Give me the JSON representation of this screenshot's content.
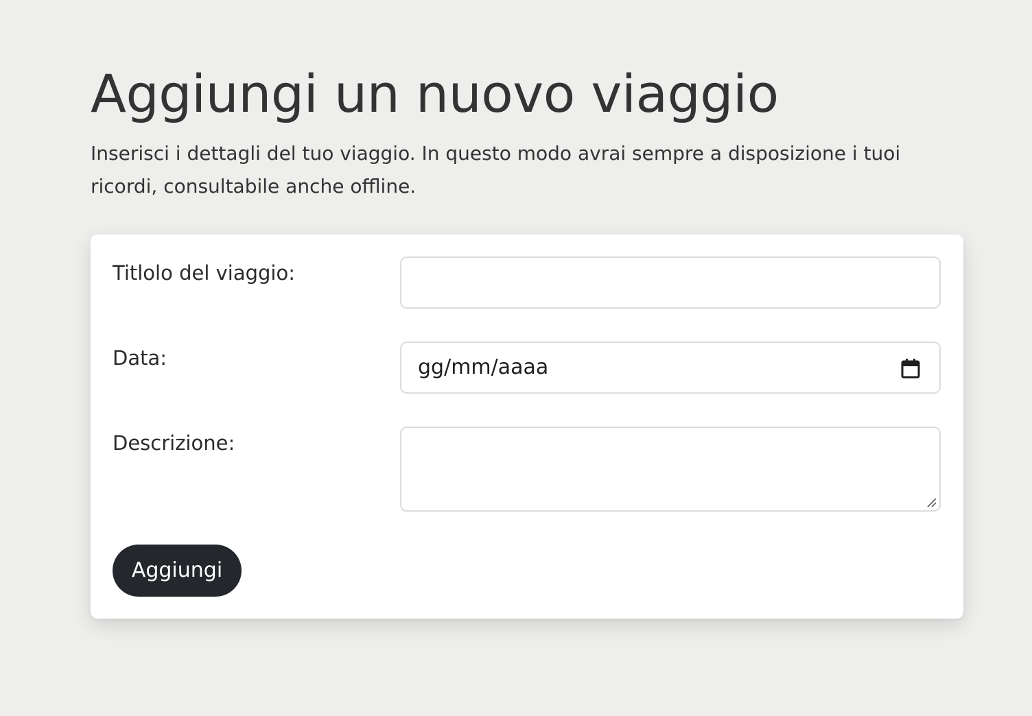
{
  "page": {
    "title": "Aggiungi un nuovo viaggio",
    "intro": "Inserisci i dettagli del tuo viaggio. In questo modo avrai sempre a disposizione i tuoi ricordi, consultabile anche offline."
  },
  "form": {
    "title_field": {
      "label": "Titlolo del viaggio:",
      "value": ""
    },
    "date_field": {
      "label": "Data:",
      "placeholder": "gg/mm/aaaa",
      "icon": "calendar-icon"
    },
    "description_field": {
      "label": "Descrizione:",
      "value": ""
    },
    "submit_label": "Aggiungi"
  },
  "colors": {
    "background": "#eeeeec",
    "card": "#ffffff",
    "button": "#24272b",
    "button_text": "#ffffff",
    "text": "#333333"
  }
}
